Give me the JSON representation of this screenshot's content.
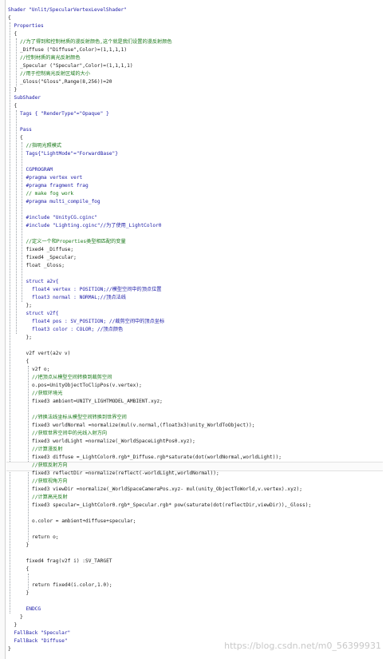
{
  "code_lines": [
    {
      "t": "Shader \"Unlit/SpecularVertexLevelShader\"",
      "c": "kw"
    },
    {
      "t": "{",
      "c": "tx"
    },
    {
      "t": "  Properties",
      "c": "kw"
    },
    {
      "t": "  {",
      "c": "tx"
    },
    {
      "t": "    //为了得到和控制材质的漫反射颜色,这个就是我们设置的漫反射颜色",
      "c": "cm"
    },
    {
      "t": "    _Diffuse (\"Diffuse\",Color)=(1,1,1,1)",
      "c": "tx"
    },
    {
      "t": "    //控制材质的高光反射颜色",
      "c": "cm"
    },
    {
      "t": "    _Specular (\"Specular\",Color)=(1,1,1,1)",
      "c": "tx"
    },
    {
      "t": "    //用于控制高光反射区域的大小",
      "c": "cm"
    },
    {
      "t": "    _Gloss(\"Gloss\",Range(8,256))=20",
      "c": "tx"
    },
    {
      "t": "  }",
      "c": "tx"
    },
    {
      "t": "  SubShader",
      "c": "kw"
    },
    {
      "t": "  {",
      "c": "tx"
    },
    {
      "t": "    Tags { \"RenderType\"=\"Opaque\" }",
      "c": "kw"
    },
    {
      "t": "",
      "c": "tx"
    },
    {
      "t": "    Pass",
      "c": "kw"
    },
    {
      "t": "    {",
      "c": "tx"
    },
    {
      "t": "      //指明光照模式",
      "c": "cm"
    },
    {
      "t": "      Tags{\"LightMode\"=\"ForwardBase\"}",
      "c": "kw"
    },
    {
      "t": "",
      "c": "tx"
    },
    {
      "t": "      CGPROGRAM",
      "c": "kw"
    },
    {
      "t": "      #pragma vertex vert",
      "c": "kw"
    },
    {
      "t": "      #pragma fragment frag",
      "c": "kw"
    },
    {
      "t": "      // make fog work",
      "c": "cm"
    },
    {
      "t": "      #pragma multi_compile_fog",
      "c": "kw"
    },
    {
      "t": "",
      "c": "tx"
    },
    {
      "t": "      #include \"UnityCG.cginc\"",
      "c": "kw"
    },
    {
      "t": "      #include \"Lighting.cginc\"//为了使用_LightColor0",
      "c": "kw"
    },
    {
      "t": "",
      "c": "tx"
    },
    {
      "t": "      //定义一个和Properties类型相匹配的变量",
      "c": "cm"
    },
    {
      "t": "      fixed4 _Diffuse;",
      "c": "tx"
    },
    {
      "t": "      fixed4 _Specular;",
      "c": "tx"
    },
    {
      "t": "      float _Gloss;",
      "c": "tx"
    },
    {
      "t": "",
      "c": "tx"
    },
    {
      "t": "      struct a2v{",
      "c": "kw"
    },
    {
      "t": "        float4 vertex : POSITION;//模型空间中的顶点位置",
      "c": "kw"
    },
    {
      "t": "        float3 normal : NORMAL;//顶点法线",
      "c": "kw"
    },
    {
      "t": "      };",
      "c": "tx"
    },
    {
      "t": "      struct v2f{",
      "c": "kw"
    },
    {
      "t": "        float4 pos : SV_POSITION; //裁剪空间中的顶点坐标",
      "c": "kw"
    },
    {
      "t": "        float3 color : COLOR; //顶点颜色",
      "c": "kw"
    },
    {
      "t": "      };",
      "c": "tx"
    },
    {
      "t": "",
      "c": "tx"
    },
    {
      "t": "      v2f vert(a2v v)",
      "c": "tx"
    },
    {
      "t": "      {",
      "c": "tx"
    },
    {
      "t": "        v2f o;",
      "c": "tx"
    },
    {
      "t": "        //把顶点从模型空间转换到裁剪空间",
      "c": "cm"
    },
    {
      "t": "        o.pos=UnityObjectToClipPos(v.vertex);",
      "c": "tx"
    },
    {
      "t": "        //获取环境光",
      "c": "cm"
    },
    {
      "t": "        fixed3 ambient=UNITY_LIGHTMODEL_AMBIENT.xyz;",
      "c": "tx"
    },
    {
      "t": "",
      "c": "tx"
    },
    {
      "t": "        //转换法线坐标从模型空间转换到世界空间",
      "c": "cm"
    },
    {
      "t": "        fixed3 worldNormal =normalize(mul(v.normal,(float3x3)unity_WorldToObject));",
      "c": "tx"
    },
    {
      "t": "        //获取世界空间中的光线入射方向",
      "c": "cm"
    },
    {
      "t": "        fixed3 worldLight =normalize(_WorldSpaceLightPos0.xyz);",
      "c": "tx"
    },
    {
      "t": "        //计算漫反射",
      "c": "cm"
    },
    {
      "t": "        fixed3 diffuse =_LightColor0.rgb*_Diffuse.rgb*saturate(dot(worldNormal,worldLight));",
      "c": "tx"
    },
    {
      "t": "        //获取反射方向",
      "c": "cm"
    },
    {
      "t": "        fixed3 reflectDir =normalize(reflect(-worldLight,worldNormal));",
      "c": "tx"
    },
    {
      "t": "        //获取视角方向",
      "c": "cm"
    },
    {
      "t": "        fixed3 viewDir =normalize(_WorldSpaceCameraPos.xyz- mul(unity_ObjectToWorld,v.vertex).xyz);",
      "c": "tx"
    },
    {
      "t": "        //计算高光反射",
      "c": "cm"
    },
    {
      "t": "        fixed3 specular=_LightColor0.rgb*_Specular.rgb* pow(saturate(dot(reflectDir,viewDir)),_Gloss);",
      "c": "tx"
    },
    {
      "t": "",
      "c": "tx"
    },
    {
      "t": "        o.color = ambient+diffuse+specular;",
      "c": "tx"
    },
    {
      "t": "",
      "c": "tx"
    },
    {
      "t": "        return o;",
      "c": "tx"
    },
    {
      "t": "      }",
      "c": "tx"
    },
    {
      "t": "",
      "c": "tx"
    },
    {
      "t": "      fixed4 frag(v2f i) :SV_TARGET",
      "c": "tx"
    },
    {
      "t": "      {",
      "c": "tx"
    },
    {
      "t": "",
      "c": "tx"
    },
    {
      "t": "        return fixed4(i.color,1.0);",
      "c": "tx"
    },
    {
      "t": "      }",
      "c": "tx"
    },
    {
      "t": "",
      "c": "tx"
    },
    {
      "t": "      ENDCG",
      "c": "kw"
    },
    {
      "t": "    }",
      "c": "tx"
    },
    {
      "t": "  }",
      "c": "tx"
    },
    {
      "t": "  FallBack \"Specular\"",
      "c": "kw"
    },
    {
      "t": "  FallBack \"Diffuse\"",
      "c": "kw"
    },
    {
      "t": "}",
      "c": "tx"
    }
  ],
  "highlighted_line": 57,
  "watermark": "https://blog.csdn.net/m0_56399931",
  "colors": {
    "keyword": "#2020a8",
    "text": "#1a1a1a",
    "comment": "#1c7a1c",
    "background": "#ffffff"
  }
}
